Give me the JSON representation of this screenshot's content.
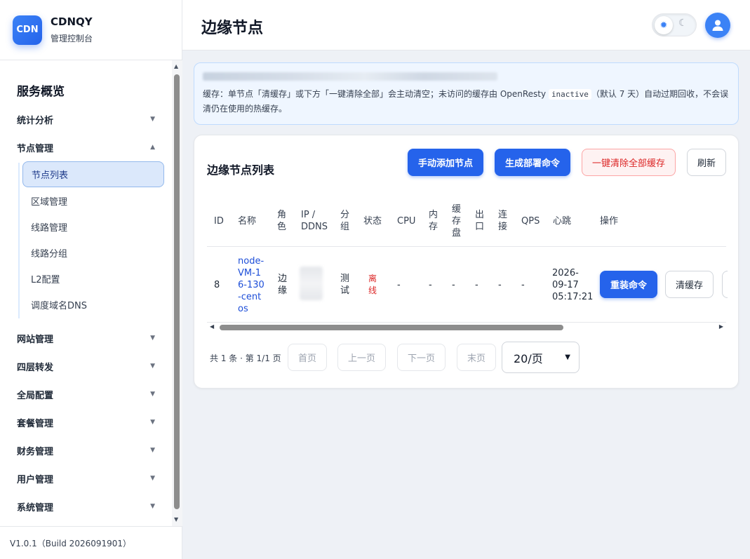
{
  "brand": {
    "logo_text": "CDN",
    "name": "CDNQY",
    "subtitle": "管理控制台"
  },
  "sidebar": {
    "title": "服务概览",
    "groups": [
      {
        "label": "统计分析",
        "expanded": false
      },
      {
        "label": "节点管理",
        "expanded": true
      },
      {
        "label": "网站管理",
        "expanded": false
      },
      {
        "label": "四层转发",
        "expanded": false
      },
      {
        "label": "全局配置",
        "expanded": false
      },
      {
        "label": "套餐管理",
        "expanded": false
      },
      {
        "label": "财务管理",
        "expanded": false
      },
      {
        "label": "用户管理",
        "expanded": false
      },
      {
        "label": "系统管理",
        "expanded": false
      }
    ],
    "sub_items": [
      {
        "label": "节点列表",
        "active": true
      },
      {
        "label": "区域管理"
      },
      {
        "label": "线路管理"
      },
      {
        "label": "线路分组"
      },
      {
        "label": "L2配置"
      },
      {
        "label": "调度域名DNS"
      }
    ],
    "version": "V1.0.1（Build 2026091901）"
  },
  "header": {
    "title": "边缘节点"
  },
  "notice": {
    "line_prefix": "缓存：单节点「清缓存」或下方「一键清除全部」会主动清空；未访问的缓存由 OpenResty ",
    "code": "inactive",
    "line_suffix": "（默认 7 天）自动过期回收，不会误清仍在使用的热缓存。"
  },
  "card": {
    "title": "边缘节点列表",
    "buttons": {
      "add": "手动添加节点",
      "deploy": "生成部署命令",
      "clear_all": "一键清除全部缓存",
      "refresh": "刷新"
    }
  },
  "table": {
    "headers": {
      "id": "ID",
      "name": "名称",
      "role": "角色",
      "ip": "IP / DDNS",
      "group": "分组",
      "status": "状态",
      "cpu": "CPU",
      "mem": "内存",
      "disk": "缓存盘",
      "out": "出口",
      "conn": "连接",
      "qps": "QPS",
      "heartbeat": "心跳",
      "ops": "操作"
    },
    "rows": [
      {
        "id": "8",
        "name": "node-VM-16-130-centos",
        "role": "边缘",
        "group": "测试",
        "status": "离线",
        "cpu": "-",
        "mem": "-",
        "disk": "-",
        "out": "-",
        "conn": "-",
        "qps": "-",
        "heartbeat": "2026-09-17 05:17:21",
        "reinstall": "重装命令",
        "clear": "清缓存"
      }
    ]
  },
  "pagination": {
    "info": "共 1 条 · 第 1/1 页",
    "first": "首页",
    "prev": "上一页",
    "next": "下一页",
    "last": "末页",
    "page_size": "20/页"
  },
  "colors": {
    "primary": "#2563eb",
    "danger": "#dc2626",
    "link": "#1d4ed8"
  }
}
